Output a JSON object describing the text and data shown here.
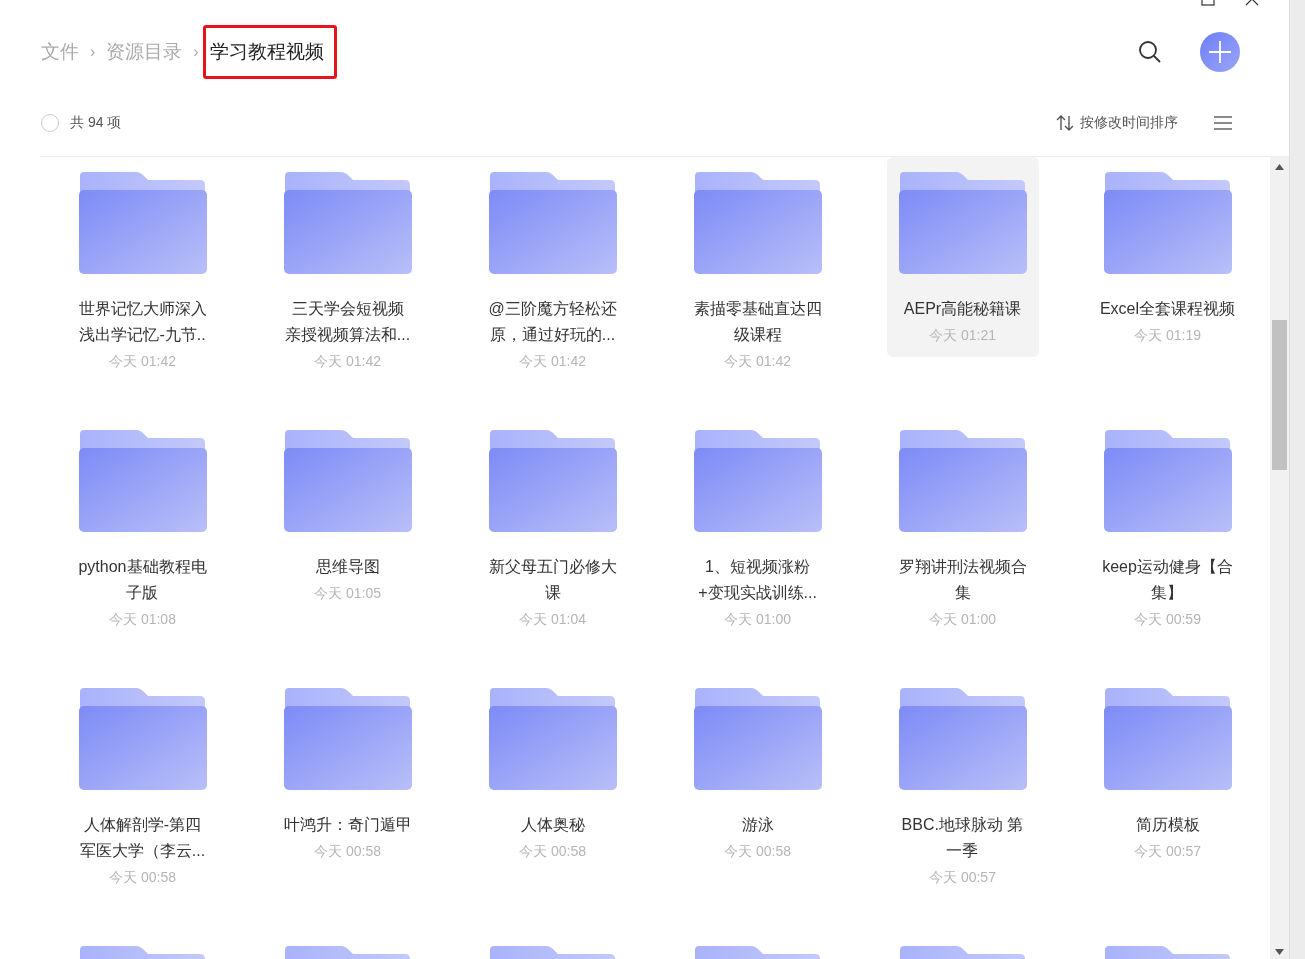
{
  "breadcrumb": [
    {
      "label": "文件",
      "current": false,
      "highlighted": false
    },
    {
      "label": "资源目录",
      "current": false,
      "highlighted": false
    },
    {
      "label": "学习教程视频",
      "current": true,
      "highlighted": true
    }
  ],
  "separator": "›",
  "toolbar": {
    "select_all_checked": false,
    "count": "共 94 项",
    "sort_label": "按修改时间排序"
  },
  "folders": [
    {
      "name_lines": [
        "世界记忆大师深入",
        "浅出学记忆-九节.."
      ],
      "time": "今天 01:42",
      "hovered": false
    },
    {
      "name_lines": [
        "三天学会短视频",
        "亲授视频算法和..."
      ],
      "time": "今天 01:42",
      "hovered": false
    },
    {
      "name_lines": [
        "@三阶魔方轻松还",
        "原，通过好玩的..."
      ],
      "time": "今天 01:42",
      "hovered": false
    },
    {
      "name_lines": [
        "素描零基础直达四",
        "级课程"
      ],
      "time": "今天 01:42",
      "hovered": false
    },
    {
      "name_lines": [
        "AEPr高能秘籍课"
      ],
      "time": "今天 01:21",
      "hovered": true
    },
    {
      "name_lines": [
        "Excel全套课程视频"
      ],
      "time": "今天 01:19",
      "hovered": false
    },
    {
      "name_lines": [
        "python基础教程电",
        "子版"
      ],
      "time": "今天 01:08",
      "hovered": false
    },
    {
      "name_lines": [
        "思维导图"
      ],
      "time": "今天 01:05",
      "hovered": false
    },
    {
      "name_lines": [
        "新父母五门必修大",
        "课"
      ],
      "time": "今天 01:04",
      "hovered": false
    },
    {
      "name_lines": [
        "1、短视频涨粉",
        "+变现实战训练..."
      ],
      "time": "今天 01:00",
      "hovered": false
    },
    {
      "name_lines": [
        "罗翔讲刑法视频合",
        "集"
      ],
      "time": "今天 01:00",
      "hovered": false
    },
    {
      "name_lines": [
        "keep运动健身【合",
        "集】"
      ],
      "time": "今天 00:59",
      "hovered": false
    },
    {
      "name_lines": [
        "人体解剖学-第四",
        "军医大学（李云..."
      ],
      "time": "今天 00:58",
      "hovered": false
    },
    {
      "name_lines": [
        "叶鸿升：奇门遁甲"
      ],
      "time": "今天 00:58",
      "hovered": false
    },
    {
      "name_lines": [
        "人体奥秘"
      ],
      "time": "今天 00:58",
      "hovered": false
    },
    {
      "name_lines": [
        "游泳"
      ],
      "time": "今天 00:58",
      "hovered": false
    },
    {
      "name_lines": [
        "BBC.地球脉动 第",
        "一季"
      ],
      "time": "今天 00:57",
      "hovered": false
    },
    {
      "name_lines": [
        "简历模板"
      ],
      "time": "今天 00:57",
      "hovered": false
    },
    {
      "hovered": false
    },
    {
      "hovered": false
    },
    {
      "hovered": false
    },
    {
      "hovered": false
    },
    {
      "hovered": false
    },
    {
      "hovered": false
    }
  ]
}
